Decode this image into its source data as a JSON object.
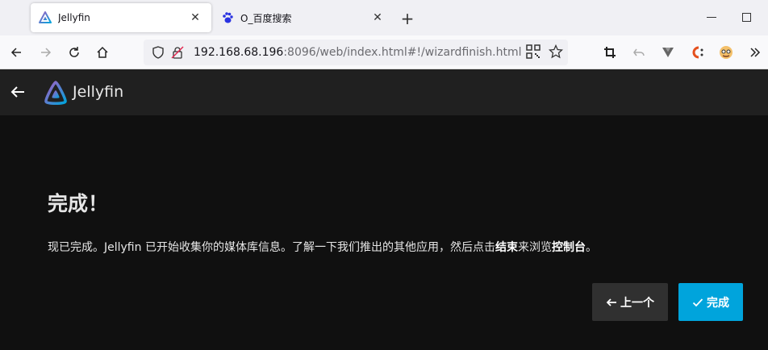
{
  "browser": {
    "tabs": [
      {
        "title": "Jellyfin",
        "active": true,
        "favicon": "jellyfin-logo-icon"
      },
      {
        "title": "O_百度搜索",
        "active": false,
        "favicon": "baidu-paw-icon"
      }
    ],
    "url": {
      "host": "192.168.68.196",
      "rest": ":8096/web/index.html#!/wizardfinish.html"
    }
  },
  "app": {
    "brand_name": "Jellyfin"
  },
  "page": {
    "title": "完成！",
    "message_part1": "现已完成。Jellyfin 已开始收集你的媒体库信息。了解一下我们推出的其他应用，然后点击",
    "message_bold1": "结束",
    "message_part2": "来浏览",
    "message_bold2": "控制台",
    "message_part3": "。",
    "prev_label": "上一个",
    "finish_label": "完成"
  },
  "colors": {
    "accent": "#00a4dc",
    "background": "#101010",
    "header": "#202020"
  }
}
